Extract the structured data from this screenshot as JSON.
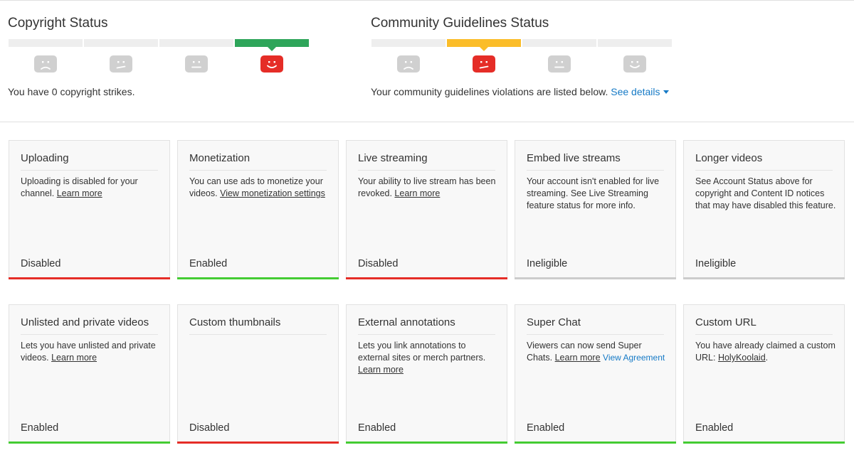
{
  "colors": {
    "enabled": "#44cc33",
    "disabled": "#e52d27",
    "ineligible": "#cccccc",
    "copyright_active": "#2ea55a",
    "community_active": "#fbbd29",
    "link_blue": "#167ac6"
  },
  "copyright": {
    "title": "Copyright Status",
    "message": "You have 0 copyright strikes.",
    "active_index": 3,
    "faces": [
      "frown-face-icon",
      "meh-face-icon",
      "neutral-face-icon",
      "smile-face-icon"
    ]
  },
  "community": {
    "title": "Community Guidelines Status",
    "message": "Your community guidelines violations are listed below.",
    "see_details": "See details",
    "active_index": 1,
    "faces": [
      "frown-face-icon",
      "meh-face-icon",
      "neutral-face-icon",
      "smile-face-icon"
    ]
  },
  "features": [
    {
      "title": "Uploading",
      "desc_text": "Uploading is disabled for your channel. ",
      "link": "Learn more",
      "status": "Disabled",
      "state": "disabled"
    },
    {
      "title": "Monetization",
      "desc_text": "You can use ads to monetize your videos. ",
      "link": "View monetization settings",
      "status": "Enabled",
      "state": "enabled"
    },
    {
      "title": "Live streaming",
      "desc_text": "Your ability to live stream has been revoked. ",
      "link": "Learn more",
      "status": "Disabled",
      "state": "disabled"
    },
    {
      "title": "Embed live streams",
      "desc_text": "Your account isn't enabled for live streaming. See Live Streaming feature status for more info.",
      "status": "Ineligible",
      "state": "ineligible"
    },
    {
      "title": "Longer videos",
      "desc_text": "See Account Status above for copyright and Content ID notices that may have disabled this feature.",
      "status": "Ineligible",
      "state": "ineligible"
    },
    {
      "title": "Unlisted and private videos",
      "desc_text": "Lets you have unlisted and private videos. ",
      "link": "Learn more",
      "status": "Enabled",
      "state": "enabled"
    },
    {
      "title": "Custom thumbnails",
      "desc_text": "",
      "status": "Disabled",
      "state": "disabled"
    },
    {
      "title": "External annotations",
      "desc_text": "Lets you link annotations to external sites or merch partners. ",
      "link": "Learn more",
      "status": "Enabled",
      "state": "enabled"
    },
    {
      "title": "Super Chat",
      "desc_text": "Viewers can now send Super Chats. ",
      "link": "Learn more",
      "link2": "View Agreement",
      "status": "Enabled",
      "state": "enabled"
    },
    {
      "title": "Custom URL",
      "desc_text": "You have already claimed a custom URL: ",
      "link": "HolyKoolaid",
      "desc_after": ".",
      "status": "Enabled",
      "state": "enabled"
    }
  ]
}
